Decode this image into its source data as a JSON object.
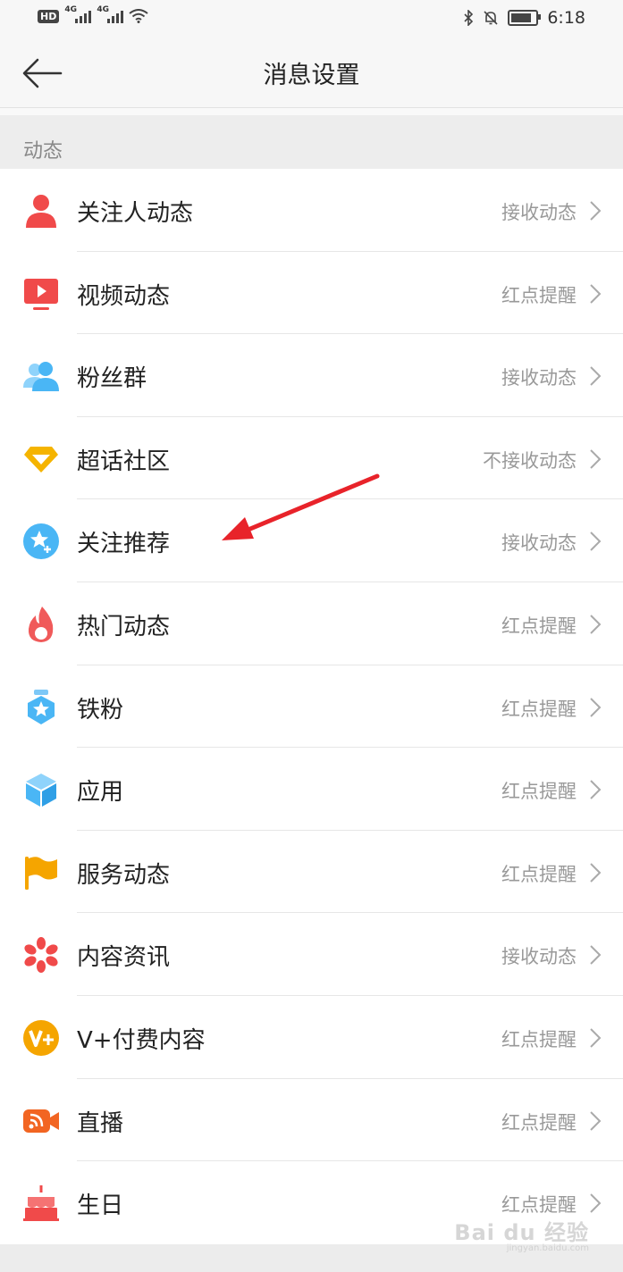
{
  "status_bar": {
    "network_badge": "HD",
    "signal1": "4G",
    "signal2": "4G",
    "time": "6:18"
  },
  "nav": {
    "title": "消息设置"
  },
  "section": {
    "title": "动态"
  },
  "rows": [
    {
      "label": "关注人动态",
      "value": "接收动态",
      "icon": "person-icon",
      "color": "#f04a4a"
    },
    {
      "label": "视频动态",
      "value": "红点提醒",
      "icon": "video-icon",
      "color": "#f04a4a"
    },
    {
      "label": "粉丝群",
      "value": "接收动态",
      "icon": "group-icon",
      "color": "#4ab6f5"
    },
    {
      "label": "超话社区",
      "value": "不接收动态",
      "icon": "diamond-icon",
      "color": "#f5b400"
    },
    {
      "label": "关注推荐",
      "value": "接收动态",
      "icon": "star-plus-icon",
      "color": "#4ab6f5"
    },
    {
      "label": "热门动态",
      "value": "红点提醒",
      "icon": "flame-icon",
      "color": "#f04a4a"
    },
    {
      "label": "铁粉",
      "value": "红点提醒",
      "icon": "medal-icon",
      "color": "#4ab6f5"
    },
    {
      "label": "应用",
      "value": "红点提醒",
      "icon": "cube-icon",
      "color": "#4ab6f5"
    },
    {
      "label": "服务动态",
      "value": "红点提醒",
      "icon": "flag-icon",
      "color": "#f5a500"
    },
    {
      "label": "内容资讯",
      "value": "接收动态",
      "icon": "flower-icon",
      "color": "#f04a4a"
    },
    {
      "label": "V+付费内容",
      "value": "红点提醒",
      "icon": "vplus-icon",
      "color": "#f5a500"
    },
    {
      "label": "直播",
      "value": "红点提醒",
      "icon": "live-icon",
      "color": "#f26522"
    },
    {
      "label": "生日",
      "value": "红点提醒",
      "icon": "cake-icon",
      "color": "#f04a4a"
    }
  ],
  "watermark": {
    "brand": "Bai du 经验",
    "url": "jingyan.baidu.com"
  }
}
